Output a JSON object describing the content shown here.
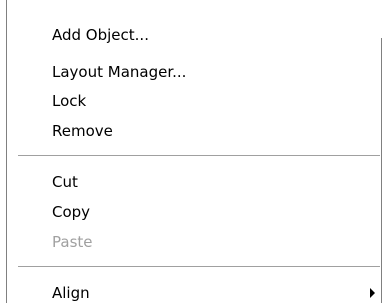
{
  "context_menu": {
    "group1": [
      {
        "label": "Add Object..."
      },
      {
        "label": "Layout Manager..."
      },
      {
        "label": "Lock"
      },
      {
        "label": "Remove"
      }
    ],
    "group2": [
      {
        "label": "Cut"
      },
      {
        "label": "Copy"
      },
      {
        "label": "Paste",
        "disabled": true
      }
    ],
    "group3": [
      {
        "label": "Align",
        "has_submenu": true,
        "submenu_icon": "chevron-right-icon"
      }
    ]
  }
}
